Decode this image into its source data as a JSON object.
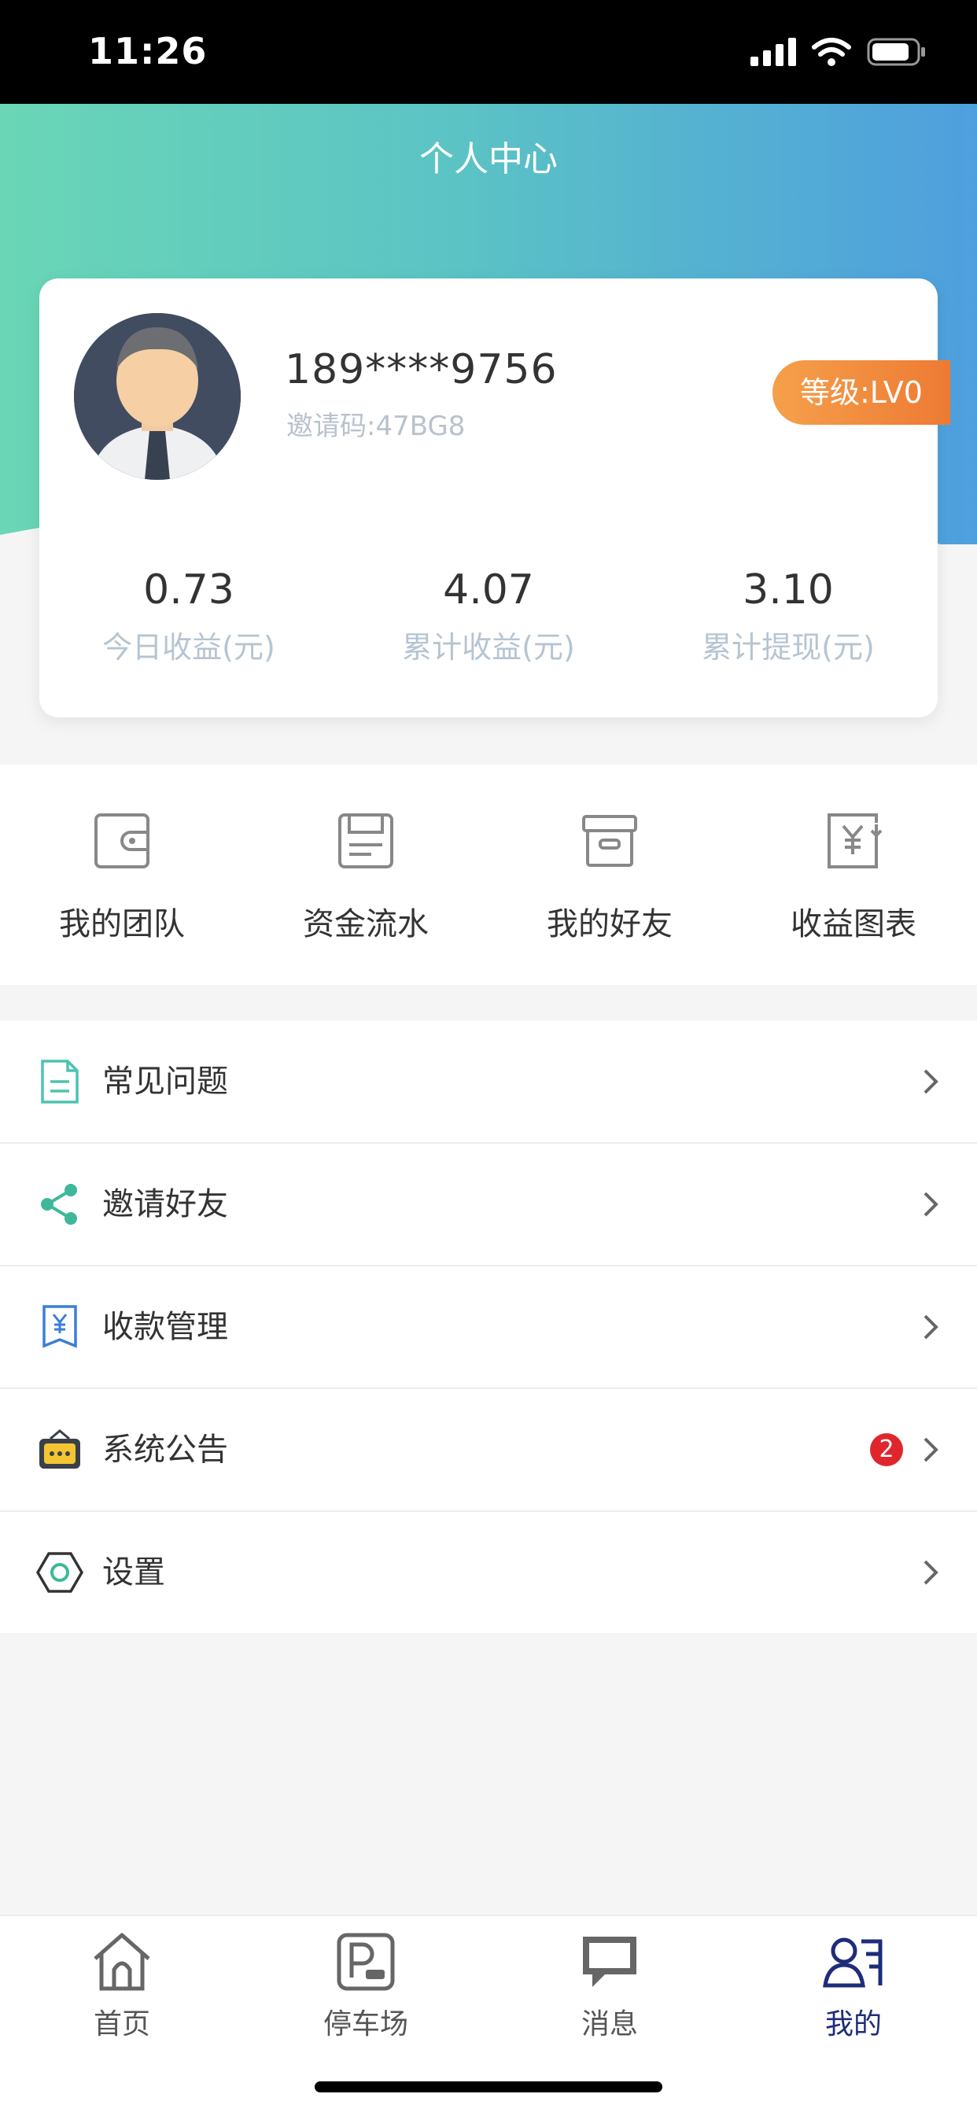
{
  "status_bar": {
    "time": "11:26"
  },
  "header": {
    "title": "个人中心"
  },
  "profile": {
    "phone": "189****9756",
    "invite_code": "邀请码:47BG8",
    "level": "等级:LV0"
  },
  "stats": [
    {
      "value": "0.73",
      "label": "今日收益(元)"
    },
    {
      "value": "4.07",
      "label": "累计收益(元)"
    },
    {
      "value": "3.10",
      "label": "累计提现(元)"
    }
  ],
  "quick_actions": [
    {
      "label": "我的团队",
      "icon": "wallet-icon"
    },
    {
      "label": "资金流水",
      "icon": "ledger-icon"
    },
    {
      "label": "我的好友",
      "icon": "box-icon"
    },
    {
      "label": "收益图表",
      "icon": "yuan-document-icon"
    }
  ],
  "menu": [
    {
      "label": "常见问题",
      "icon": "document-icon",
      "badge": ""
    },
    {
      "label": "邀请好友",
      "icon": "share-icon",
      "badge": ""
    },
    {
      "label": "收款管理",
      "icon": "yuan-bookmark-icon",
      "badge": ""
    },
    {
      "label": "系统公告",
      "icon": "radio-icon",
      "badge": "2"
    },
    {
      "label": "设置",
      "icon": "hexagon-settings-icon",
      "badge": ""
    }
  ],
  "tabs": [
    {
      "label": "首页",
      "icon": "home-icon",
      "active": false
    },
    {
      "label": "停车场",
      "icon": "parking-icon",
      "active": false
    },
    {
      "label": "消息",
      "icon": "message-icon",
      "active": false
    },
    {
      "label": "我的",
      "icon": "profile-icon",
      "active": true
    }
  ],
  "colors": {
    "gradient_start": "#6ad6b6",
    "gradient_end": "#4e9fde",
    "badge_orange": "#ee7a33",
    "notification_red": "#e0262d",
    "active_tab": "#1e2c7a"
  }
}
